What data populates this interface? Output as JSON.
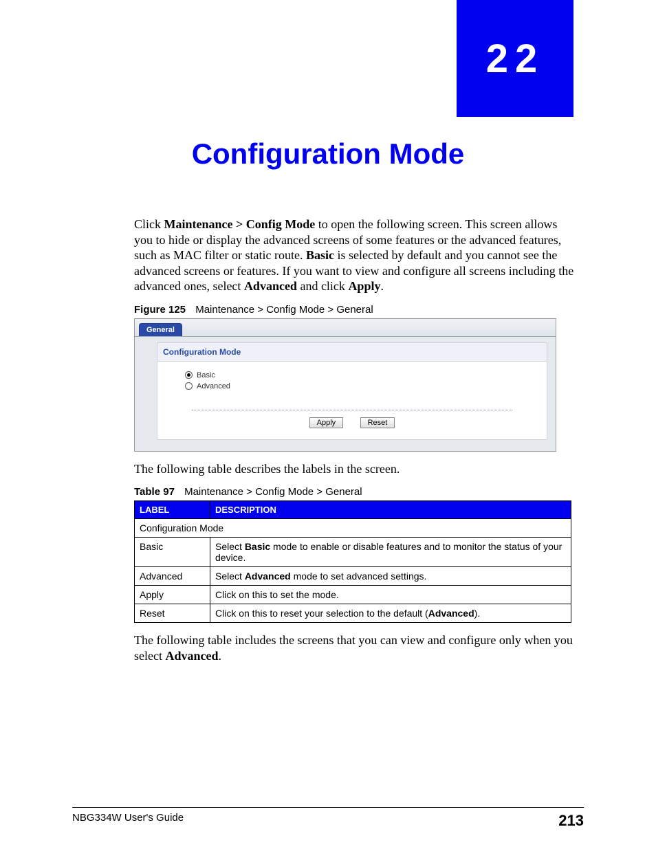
{
  "chapter": {
    "number": "22",
    "title": "Configuration Mode"
  },
  "intro": {
    "run1": "Click ",
    "nav_bold": "Maintenance > Config Mode",
    "run2": " to open the following screen. This screen allows you to hide or display the advanced screens of some features or the advanced features, such as MAC filter or static route. ",
    "basic_bold": "Basic",
    "run3": " is selected by default and you cannot see the advanced screens or features. If you want to view and configure all screens including the advanced ones, select ",
    "advanced_bold": "Advanced",
    "run4": " and click ",
    "apply_bold": "Apply",
    "run5": "."
  },
  "figure": {
    "label": "Figure 125",
    "caption": "Maintenance > Config Mode > General"
  },
  "screenshot": {
    "tab": "General",
    "section": "Configuration Mode",
    "options": {
      "basic": "Basic",
      "advanced": "Advanced"
    },
    "buttons": {
      "apply": "Apply",
      "reset": "Reset"
    }
  },
  "after_figure": "The following table describes the labels in the screen.",
  "table_caption": {
    "label": "Table 97",
    "caption": "Maintenance > Config Mode > General"
  },
  "table": {
    "headers": {
      "label": "LABEL",
      "desc": "DESCRIPTION"
    },
    "section_row": "Configuration Mode",
    "rows": {
      "r1": {
        "label": "Basic",
        "d_pre": "Select ",
        "d_bold": "Basic",
        "d_post": " mode to enable or disable features and to monitor the status of your device."
      },
      "r2": {
        "label": "Advanced",
        "d_pre": "Select ",
        "d_bold": "Advanced",
        "d_post": " mode to set advanced settings."
      },
      "r3": {
        "label": "Apply",
        "d_pre": "Click on this to set the mode.",
        "d_bold": "",
        "d_post": ""
      },
      "r4": {
        "label": "Reset",
        "d_pre": "Click on this to reset your selection to the default (",
        "d_bold": "Advanced",
        "d_post": ")."
      }
    }
  },
  "after_table": {
    "run1": "The following table includes the screens that you can view and configure only when you select ",
    "bold": "Advanced",
    "run2": "."
  },
  "footer": {
    "guide": "NBG334W User's Guide",
    "page": "213"
  }
}
